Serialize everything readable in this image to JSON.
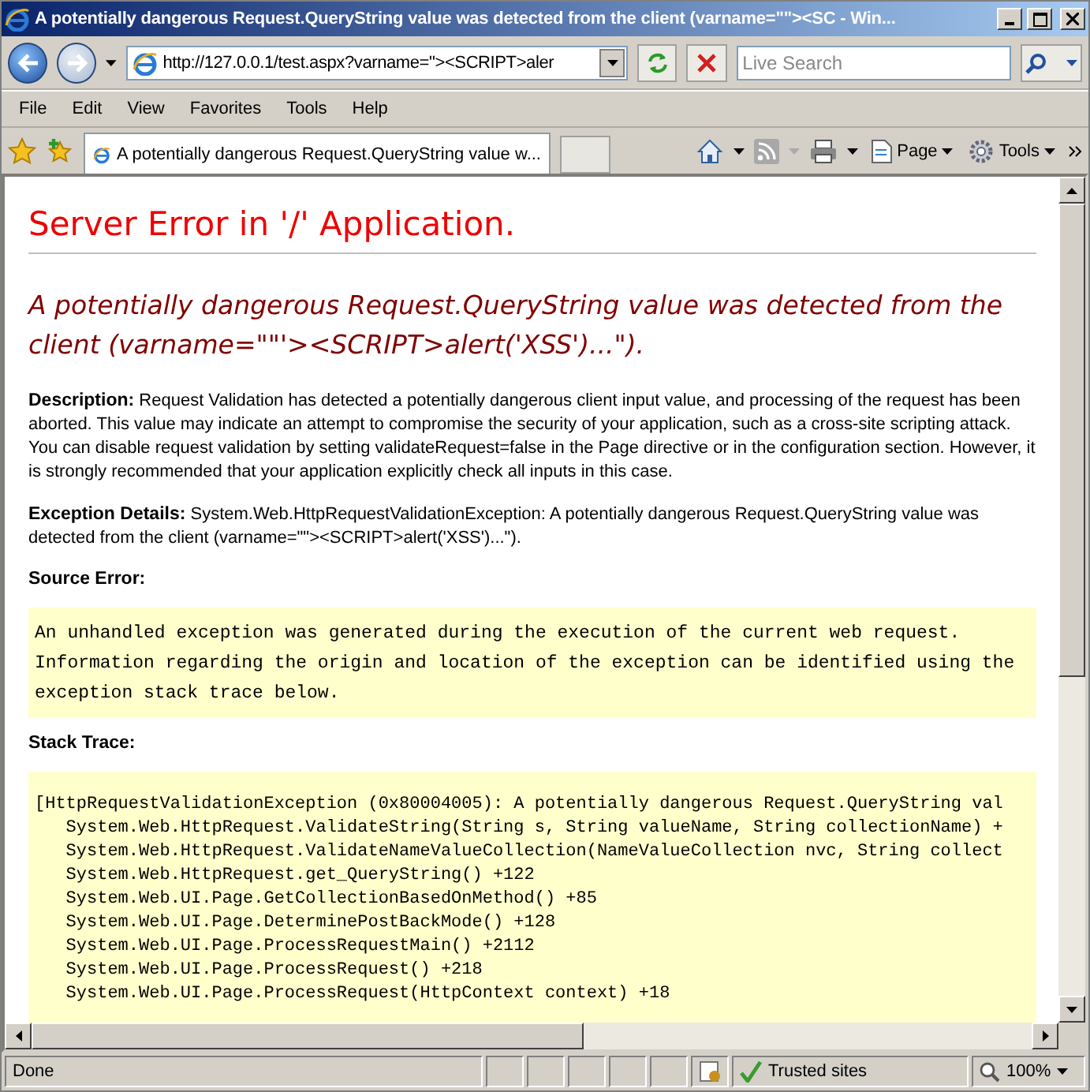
{
  "window": {
    "title": "A potentially dangerous Request.QueryString value was detected from the client (varname=\"\"><SC - Win..."
  },
  "address_bar": {
    "value": "http://127.0.0.1/test.aspx?varname=\"><SCRIPT>aler"
  },
  "search": {
    "placeholder": "Live Search"
  },
  "menu": [
    "File",
    "Edit",
    "View",
    "Favorites",
    "Tools",
    "Help"
  ],
  "tabs": [
    {
      "label": "A potentially dangerous Request.QueryString value w...",
      "selected": true
    }
  ],
  "command_bar": [
    "Page",
    "Tools"
  ],
  "page": {
    "heading": "Server Error in '/' Application.",
    "error_title": "A potentially dangerous Request.QueryString value was detected from the client (varname=\"\"'><SCRIPT>alert('XSS')...\").",
    "description": "**Description:** Request Validation has detected a potentially dangerous client input value, and processing of the request has been aborted. This value may indicate an attempt to compromise the security of your application, such as a cross-site scripting attack. You can disable request validation by setting validateRequest=false in the Page directive or in the configuration section. However, it is strongly recommended that your application explicitly check all inputs in this case.",
    "exception_details": "**Exception Details:** System.Web.HttpRequestValidationException: A potentially dangerous Request.QueryString value was detected from the client (varname=\"\"><SCRIPT>alert('XSS')...\").",
    "source_error_label": "Source Error:",
    "source_error": "An unhandled exception was generated during the execution of the current web request. Information regarding the origin and location of the exception can be identified using the exception stack trace below.",
    "stack_trace_label": "Stack Trace:",
    "stack_trace": [
      "[HttpRequestValidationException (0x80004005): A potentially dangerous Request.QueryString val",
      "   System.Web.HttpRequest.ValidateString(String s, String valueName, String collectionName) +",
      "   System.Web.HttpRequest.ValidateNameValueCollection(NameValueCollection nvc, String collect",
      "   System.Web.HttpRequest.get_QueryString() +122",
      "   System.Web.UI.Page.GetCollectionBasedOnMethod() +85",
      "   System.Web.UI.Page.DeterminePostBackMode() +128",
      "   System.Web.UI.Page.ProcessRequestMain() +2112",
      "   System.Web.UI.Page.ProcessRequest() +218",
      "   System.Web.UI.Page.ProcessRequest(HttpContext context) +18"
    ]
  },
  "status_bar": {
    "status": "Done",
    "zone": "Trusted sites",
    "zoom": "100%"
  }
}
